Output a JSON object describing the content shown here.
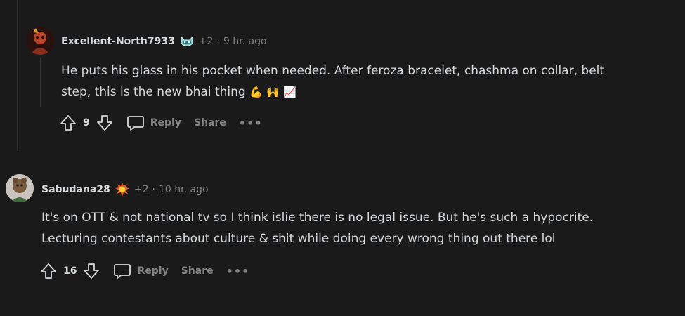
{
  "top_partial": "...",
  "comments": [
    {
      "username": "Excellent-North7933",
      "flair_icon": "cat-face-icon",
      "karma": "+2",
      "separator": "·",
      "time": "9 hr. ago",
      "text_line1": "He puts his glass in his pocket when needed. After feroza bracelet, chashma on collar, belt",
      "text_line2": "step, this is the new bhai thing",
      "emojis": [
        "💪",
        "🙌",
        "📈"
      ],
      "votes": "9",
      "reply_label": "Reply",
      "share_label": "Share",
      "more_label": "•••"
    },
    {
      "username": "Sabudana28",
      "flair_icon": "fire-burst-icon",
      "karma": "+2",
      "separator": "·",
      "time": "10 hr. ago",
      "text_line1": "It's on OTT & not national tv so I think islie there is no legal issue. But he's such a hypocrite.",
      "text_line2": "Lecturing contestants about culture & shit while doing every wrong thing out there lol",
      "votes": "16",
      "reply_label": "Reply",
      "share_label": "Share",
      "more_label": "•••"
    }
  ]
}
